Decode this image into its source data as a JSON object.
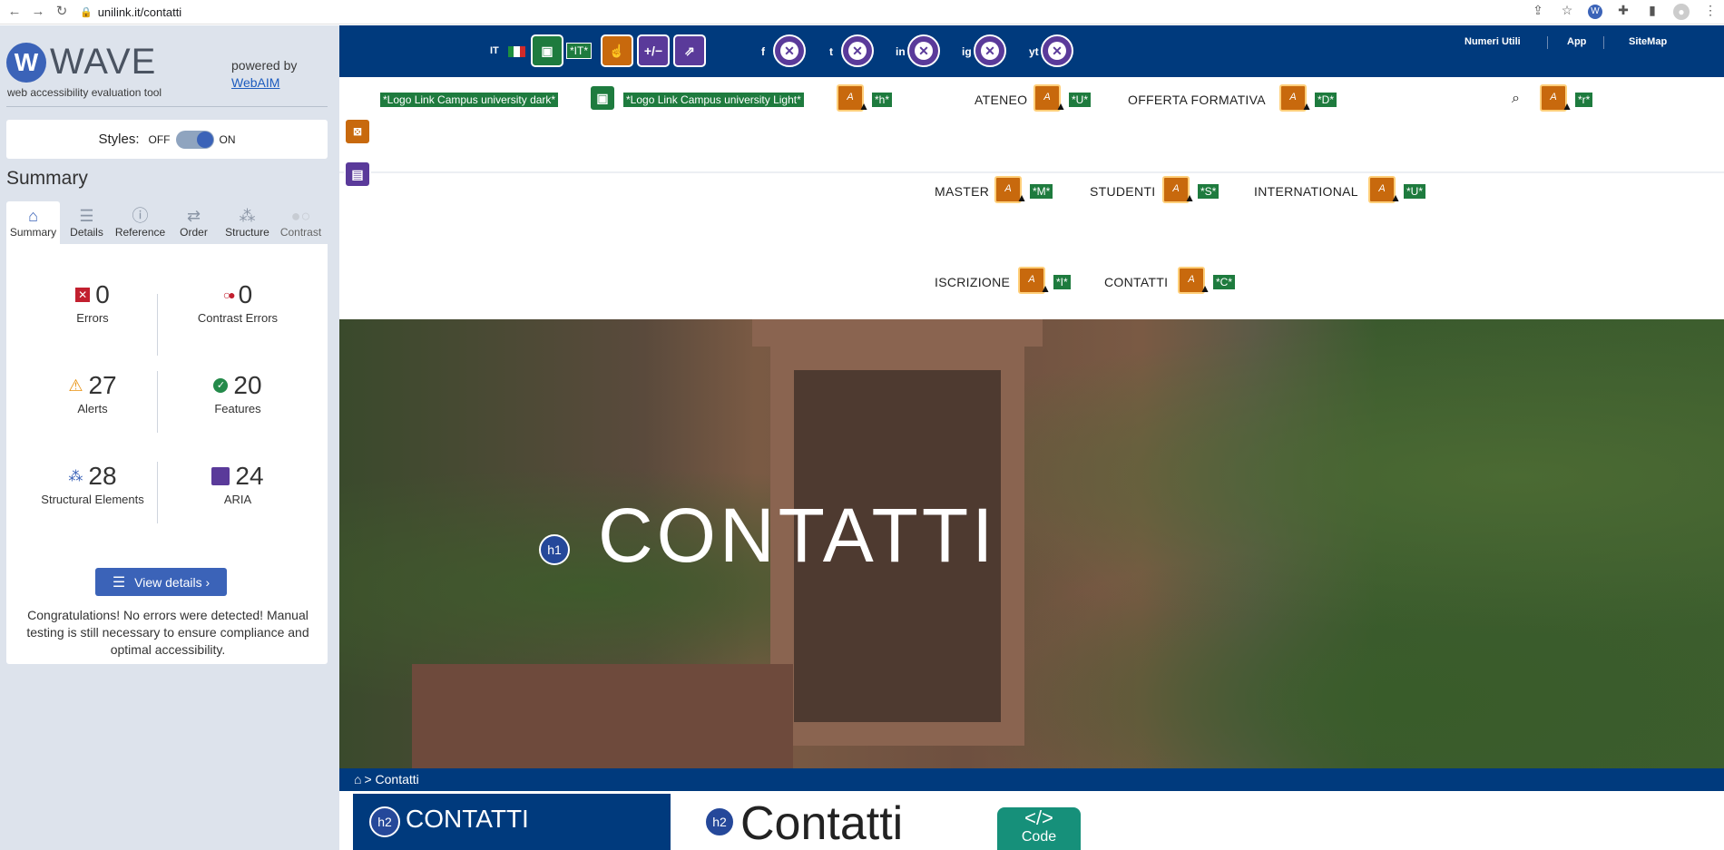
{
  "browser": {
    "url": "unilink.it/contatti",
    "back_icon": "arrow-left-icon",
    "forward_icon": "arrow-right-icon",
    "reload_icon": "reload-icon"
  },
  "wave": {
    "logo_word": "WAVE",
    "logo_letter": "W",
    "tagline": "web accessibility evaluation tool",
    "powered_by": "powered by",
    "webaim": "WebAIM",
    "styles_label": "Styles:",
    "styles_off": "OFF",
    "styles_on": "ON",
    "styles_enabled": true,
    "summary_title": "Summary",
    "tabs": [
      "Summary",
      "Details",
      "Reference",
      "Order",
      "Structure",
      "Contrast"
    ],
    "active_tab": "Summary",
    "stats": {
      "errors": {
        "value": "0",
        "label": "Errors"
      },
      "contrast_errors": {
        "value": "0",
        "label": "Contrast Errors"
      },
      "alerts": {
        "value": "27",
        "label": "Alerts"
      },
      "features": {
        "value": "20",
        "label": "Features"
      },
      "structural": {
        "value": "28",
        "label": "Structural Elements"
      },
      "aria": {
        "value": "24",
        "label": "ARIA"
      }
    },
    "view_details": "View details ›",
    "congrats": "Congratulations! No errors were detected! Manual testing is still necessary to ensure compliance and optimal accessibility."
  },
  "site": {
    "colors": {
      "brand": "#003a7d",
      "wave_feature": "#1e7b3e",
      "wave_alert": "#c8690d",
      "wave_aria": "#5a3a9a"
    },
    "lang": "IT",
    "lang_tag": "*IT*",
    "utility": {
      "numeri_utili": "Numeri Utili",
      "app": "App",
      "sitemap": "SiteMap"
    },
    "social": [
      "f",
      "t",
      "in",
      "ig",
      "yt"
    ],
    "logo_dark": "*Logo Link Campus university dark*",
    "logo_light": "*Logo Link Campus university Light*",
    "nav_tags": {
      "h": "*h*",
      "ateneo": "*U*",
      "offerta": "*D*",
      "search": "*r*",
      "master": "*M*",
      "studenti": "*S*",
      "international": "*U*",
      "iscrizione": "*I*",
      "contatti": "*C*"
    },
    "nav": {
      "ateneo": "ATENEO",
      "offerta": "OFFERTA FORMATIVA",
      "master": "MASTER",
      "studenti": "STUDENTI",
      "international": "INTERNATIONAL",
      "iscrizione": "ISCRIZIONE",
      "contatti": "CONTATTI"
    },
    "hero_title": "CONTATTI",
    "h1_badge": "h1",
    "breadcrumb": "> Contatti",
    "side_title": "CONTATTI",
    "main_title": "Contatti",
    "h2_badge": "h2",
    "code_icon": "</>",
    "code_label": "Code"
  }
}
